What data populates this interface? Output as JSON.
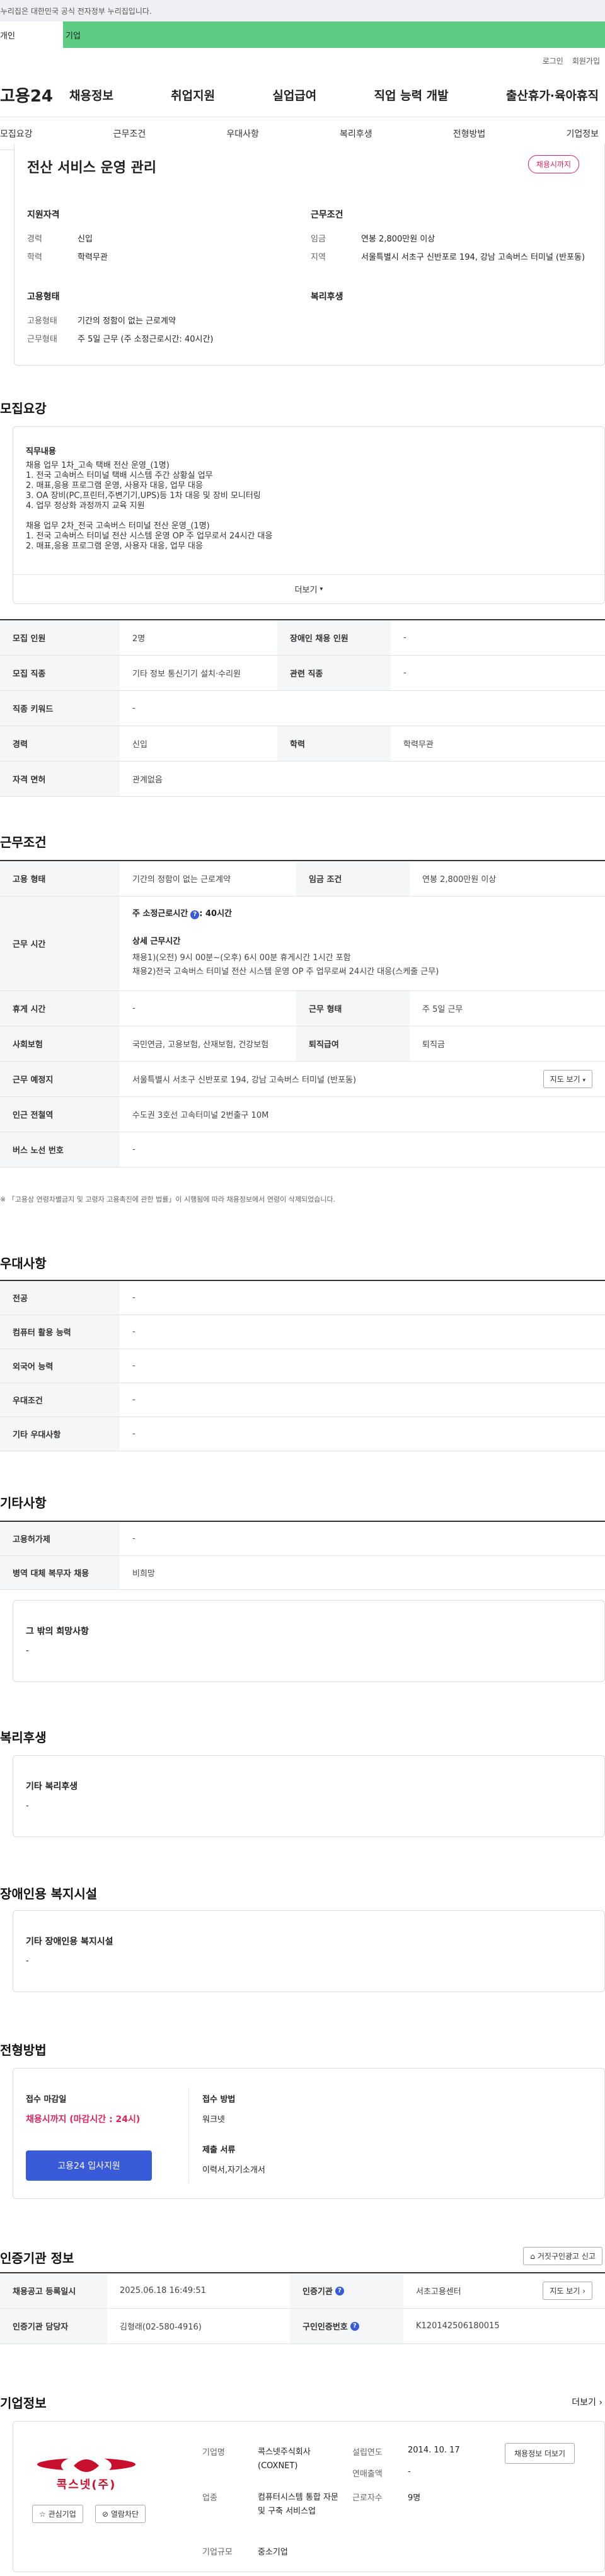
{
  "notice": "이 누리집은 대한민국 공식 전자정부 누리집입니다.",
  "gnb_tabs": [
    "개인",
    "기업"
  ],
  "util": [
    "로그인",
    "회원가입"
  ],
  "logo": "고용24",
  "nav": [
    "채용정보",
    "취업지원",
    "실업급여",
    "직업 능력 개발",
    "출산휴가·육아휴직"
  ],
  "subnav": [
    "모집요강",
    "근무조건",
    "우대사항",
    "복리후생",
    "전형방법",
    "기업정보"
  ],
  "summary": {
    "title": "전산 서비스 운영 관리",
    "badge": "채용시까지",
    "qual_title": "지원자격",
    "cond_title": "근무조건",
    "career_label": "경력",
    "career": "신입",
    "edu_label": "학력",
    "edu": "학력무관",
    "wage_label": "임금",
    "wage": "연봉 2,800만원 이상",
    "area_label": "지역",
    "area": "서울특별시 서초구 신반포로 194, 강남 고속버스 터미널 (반포동)",
    "emp_title": "고용형태",
    "welfare_title": "복리후생",
    "emptype_label": "고용형태",
    "emptype": "기간의 정함이 없는 근로계약",
    "worktype_label": "근무형태",
    "worktype": "주 5일 근무 (주 소정근로시간: 40시간)"
  },
  "recruit": {
    "title": "모집요강",
    "duty_title": "직무내용",
    "duty_lines": [
      "채용 업무 1차_고속 택배 전산 운영_(1명)",
      "1. 전국 고속버스 터미널 택배 시스템 주간 상황실 업무",
      "2. 매표,응용 프로그램 운영, 사용자 대응, 업무 대응",
      "3. OA 장비(PC,프린터,주변기기,UPS)등 1차 대응 및 장비 모니터링",
      "4. 업무 정상화 과정까지 교육 지원",
      "",
      "채용 업무 2차_전국 고속버스 터미널 전산 운영_(1명)",
      "1. 전국 고속버스 터미널 전산 시스템 운영 OP 주 업무로서 24시간 대응",
      "2. 매표,응용 프로그램 운영, 사용자 대응, 업무 대응"
    ],
    "more": "더보기",
    "rows": [
      {
        "k1": "모집 인원",
        "v1": "2명",
        "k2": "장애인 채용 인원",
        "v2": "-"
      },
      {
        "k1": "모집 직종",
        "v1": "기타 정보 통신기기 설치·수리원",
        "k2": "관련 직종",
        "v2": "-"
      },
      {
        "k1": "직종 키워드",
        "v1": "-"
      },
      {
        "k1": "경력",
        "v1": "신입",
        "k2": "학력",
        "v2": "학력무관"
      },
      {
        "k1": "자격 면허",
        "v1": "관계없음"
      }
    ]
  },
  "cond": {
    "title": "근무조건",
    "emptype_k": "고용 형태",
    "emptype_v": "기간의 정함이 없는 근로계약",
    "wage_k": "임금 조건",
    "wage_v": "연봉 2,800만원 이상",
    "time_k": "근무 시간",
    "time_main": "주 소정근로시간",
    "time_hours": ": 40시간",
    "time_detail_title": "상세 근무시간",
    "time_detail_1": "채용1)(오전) 9시 00분~(오후) 6시 00분 휴게시간 1시간 포함",
    "time_detail_2": "채용2)전국 고속버스 터미널 전산 시스템 운영 OP 주 업무로써 24시간 대응(스케줄 근무)",
    "rest_k": "휴게 시간",
    "rest_v": "-",
    "form_k": "근무 형태",
    "form_v": "주 5일 근무",
    "ins_k": "사회보험",
    "ins_v": "국민연금, 고용보험, 산재보험, 건강보험",
    "ret_k": "퇴직급여",
    "ret_v": "퇴직금",
    "place_k": "근무 예정지",
    "place_v": "서울특별시 서초구 신반포로 194, 강남 고속버스 터미널 (반포동)",
    "map_btn": "지도 보기",
    "subway_k": "인근 전철역",
    "subway_v": "수도권 3호선 고속터미널 2번출구 10M",
    "bus_k": "버스 노선 번호",
    "bus_v": "-",
    "note": "「고용상 연령차별금지 및 고령자 고용촉진에 관한 법률」이 시행됨에 따라 채용정보에서 연령이 삭제되었습니다."
  },
  "pref": {
    "title": "우대사항",
    "rows": [
      [
        "전공",
        "-"
      ],
      [
        "컴퓨터 활용 능력",
        "-"
      ],
      [
        "외국어 능력",
        "-"
      ],
      [
        "우대조건",
        "-"
      ],
      [
        "기타 우대사항",
        "-"
      ]
    ]
  },
  "etc": {
    "title": "기타사항",
    "rows": [
      [
        "고용허가제",
        "-"
      ],
      [
        "병역 대체 복무자 채용",
        "비희망"
      ]
    ],
    "other_title": "그 밖의 희망사항",
    "other_v": "-"
  },
  "welfare": {
    "title": "복리후생",
    "box_title": "기타 복리후생",
    "box_v": "-"
  },
  "disabled": {
    "title": "장애인용 복지시설",
    "box_title": "기타 장애인용 복지시설",
    "box_v": "-"
  },
  "process": {
    "title": "전형방법",
    "deadline_k": "접수 마감일",
    "deadline_v": "채용시까지 (마감시간 : 24시)",
    "method_k": "접수 방법",
    "method_v": "워크넷",
    "docs_k": "제출 서류",
    "docs_v": "이력서,자기소개서",
    "apply_btn": "고용24 입사지원"
  },
  "agency": {
    "title": "인증기관 정보",
    "report_btn": "거짓구인광고 신고",
    "reg_k": "채용공고 등록일시",
    "reg_v": "2025.06.18 16:49:51",
    "org_k": "인증기관",
    "org_v": "서초고용센터",
    "map_btn": "지도 보기",
    "mgr_k": "인증기관 담당자",
    "mgr_v": "김형래(02-580-4916)",
    "num_k": "구인인증번호",
    "num_v": "K120142506180015"
  },
  "company": {
    "title": "기업정보",
    "more": "더보기",
    "logo_text": "콕스넷(주)",
    "fav_btn": "관심기업",
    "block_btn": "열람차단",
    "name_k": "기업명",
    "name_v": "콕스넷주식회사 (COXNET)",
    "biz_k": "업종",
    "biz_v": "컴퓨터시스템 통합 자문 및 구축 서비스업",
    "size_k": "기업규모",
    "size_v": "중소기업",
    "year_k": "설립연도",
    "year_v": "2014. 10. 17",
    "sales_k": "연매출액",
    "sales_v": "-",
    "emp_k": "근로자수",
    "emp_v": "9명",
    "jobs_btn": "채용정보 더보기"
  },
  "colors": {
    "brand_green": "#5ecb82",
    "accent_blue": "#3a5bd9",
    "badge_red": "#e0245e"
  }
}
